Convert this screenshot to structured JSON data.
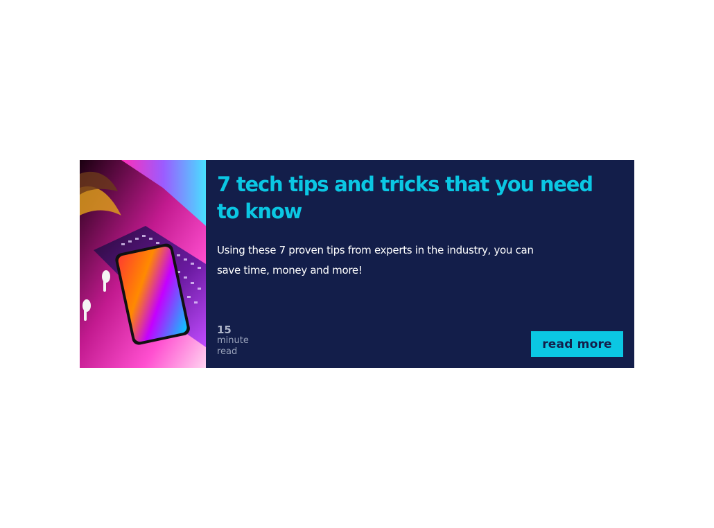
{
  "card": {
    "title": "7 tech tips and tricks that you need to know",
    "description": "Using these 7 proven tips from experts in the industry, you can save time, money and more!",
    "read_time": {
      "number": "15",
      "unit_line1": "minute",
      "unit_line2": "read"
    },
    "button_label": "read more",
    "image_icon": "laptop-phone-photo"
  },
  "colors": {
    "card_background": "#131e4a",
    "accent": "#0bc7e3",
    "text": "#ffffff",
    "muted_text": "#9aa3bb"
  }
}
